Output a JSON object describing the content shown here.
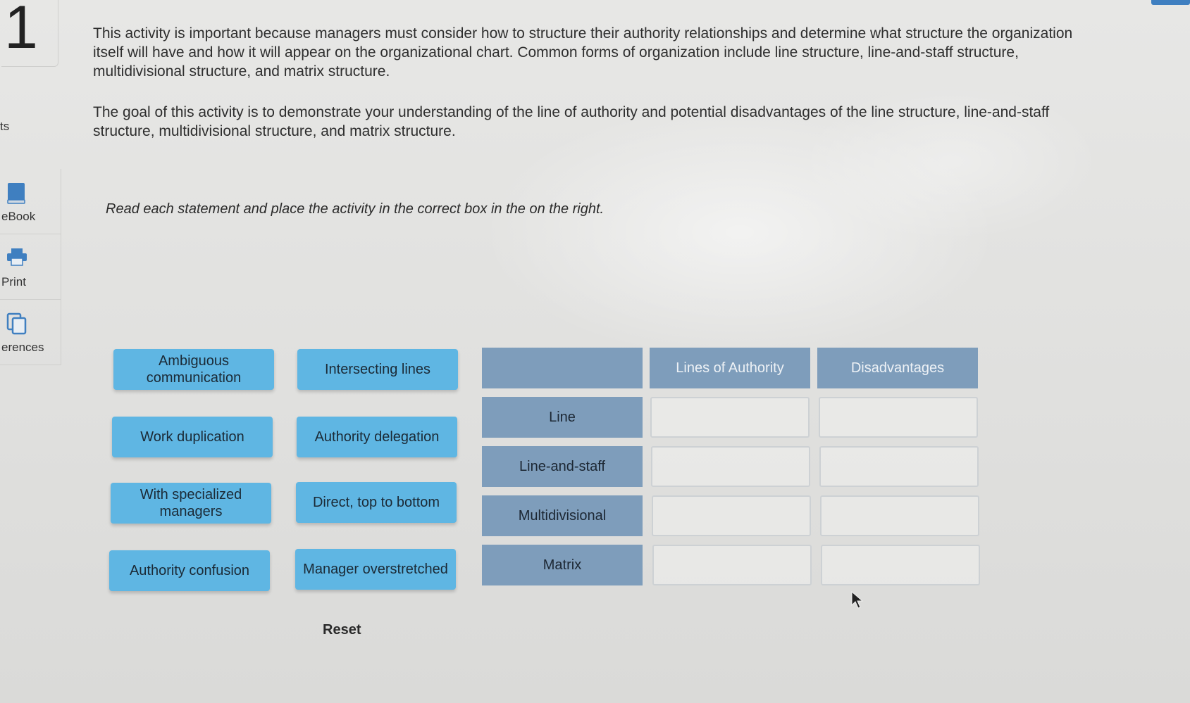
{
  "sidebar": {
    "step_number": "1",
    "items": [
      {
        "label": "ts",
        "icon": "none"
      },
      {
        "label": "eBook",
        "icon": "book-icon"
      },
      {
        "label": "Print",
        "icon": "printer-icon"
      },
      {
        "label": "erences",
        "icon": "references-icon"
      }
    ]
  },
  "content": {
    "paragraph1": "This activity is important because managers must consider how to structure their authority relationships and determine what structure the organization itself will have and how it will appear on the organizational chart. Common forms of organization include line structure, line-and-staff structure, multidivisional structure, and matrix structure.",
    "paragraph2": "The goal of this activity is to demonstrate your understanding of the line of authority and potential disadvantages of the line structure, line-and-staff structure, multidivisional structure, and matrix structure.",
    "instructions": "Read each statement and place the activity in the correct box in the on the right."
  },
  "chips": [
    {
      "label": "Ambiguous communication"
    },
    {
      "label": "Intersecting lines"
    },
    {
      "label": "Work duplication"
    },
    {
      "label": "Authority delegation"
    },
    {
      "label": "With specialized managers"
    },
    {
      "label": "Direct, top to bottom"
    },
    {
      "label": "Authority confusion"
    },
    {
      "label": "Manager overstretched"
    }
  ],
  "table": {
    "columns": [
      "",
      "Lines of Authority",
      "Disadvantages"
    ],
    "rows": [
      "Line",
      "Line-and-staff",
      "Multidivisional",
      "Matrix"
    ]
  },
  "reset_label": "Reset",
  "colors": {
    "chip": "#5fb6e3",
    "table_header": "#7e9dbb",
    "accent_bar": "#3f7fc0"
  }
}
